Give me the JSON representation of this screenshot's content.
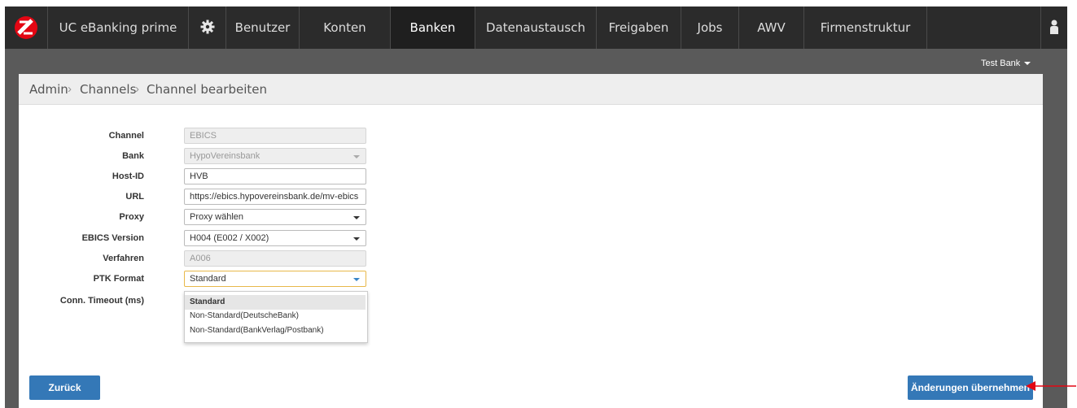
{
  "navbar": {
    "app_title": "UC eBanking prime",
    "items": [
      "Benutzer",
      "Konten",
      "Banken",
      "Datenaustausch",
      "Freigaben",
      "Jobs",
      "AWV",
      "Firmenstruktur"
    ],
    "active": "Banken",
    "icons": {
      "logo": "brand-logo-icon",
      "settings": "gear-icon",
      "user": "user-icon"
    },
    "colors": {
      "bar": "#2b2b2b",
      "logo": "#e30613"
    }
  },
  "bank_selector": {
    "label": "Test Bank"
  },
  "breadcrumb": [
    "Admin",
    "Channels",
    "Channel bearbeiten"
  ],
  "form": {
    "channel": {
      "label": "Channel",
      "value": "EBICS"
    },
    "bank": {
      "label": "Bank",
      "value": "HypoVereinsbank"
    },
    "host_id": {
      "label": "Host-ID",
      "value": "HVB"
    },
    "url": {
      "label": "URL",
      "value": "https://ebics.hypovereinsbank.de/mv-ebics"
    },
    "proxy": {
      "label": "Proxy",
      "value": "Proxy wählen"
    },
    "ebics_version": {
      "label": "EBICS Version",
      "value": "H004 (E002 / X002)"
    },
    "verfahren": {
      "label": "Verfahren",
      "value": "A006"
    },
    "ptk_format": {
      "label": "PTK Format",
      "value": "Standard"
    },
    "conn_timeout": {
      "label": "Conn. Timeout (ms)"
    }
  },
  "ptk_dropdown": {
    "options": [
      "Standard",
      "Non-Standard(DeutscheBank)",
      "Non-Standard(BankVerlag/Postbank)"
    ],
    "selected": "Standard"
  },
  "buttons": {
    "back": "Zurück",
    "apply": "Änderungen übernehmen"
  },
  "annotation": {
    "arrow_color": "#e30613"
  }
}
